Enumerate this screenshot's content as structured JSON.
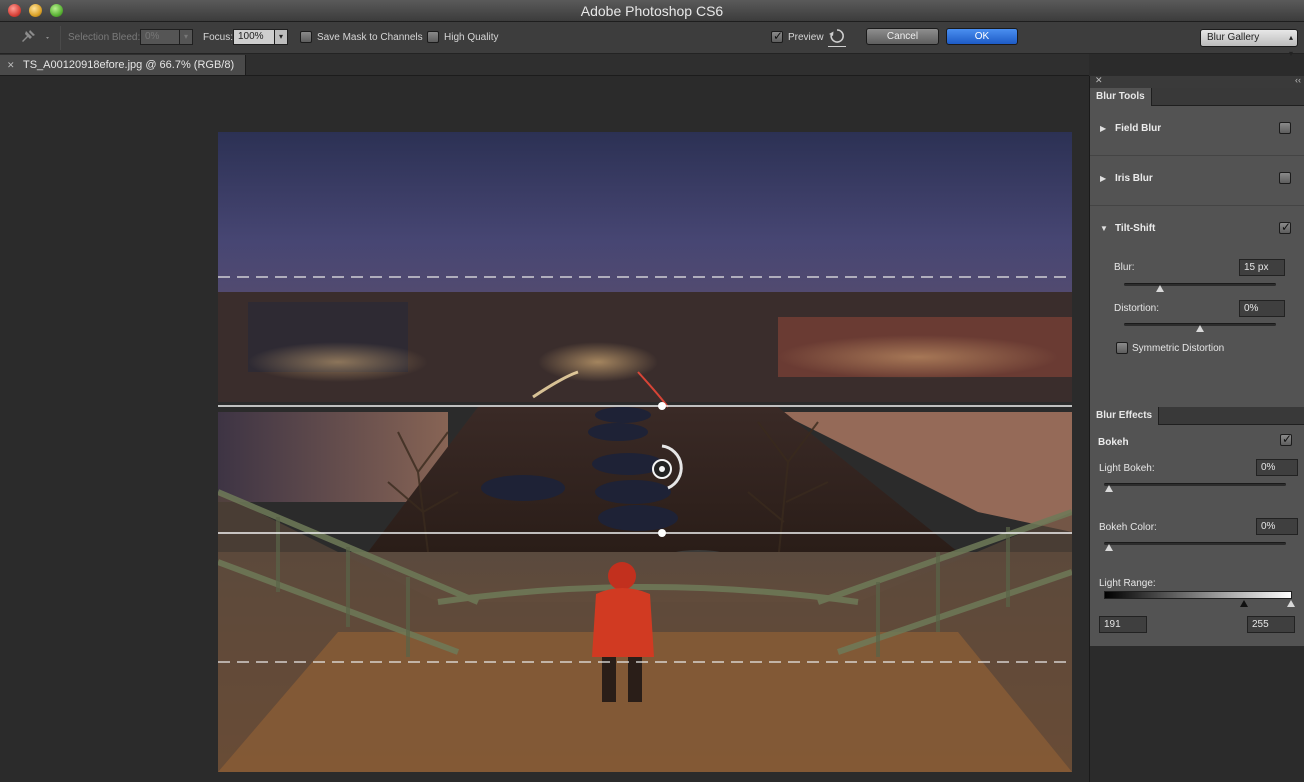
{
  "window": {
    "title": "Adobe Photoshop CS6"
  },
  "options_bar": {
    "selection_bleed_label": "Selection Bleed:",
    "selection_bleed_value": "0%",
    "focus_label": "Focus:",
    "focus_value": "100%",
    "save_mask_label": "Save Mask to Channels",
    "high_quality_label": "High Quality",
    "preview_label": "Preview",
    "preview_checked": true,
    "cancel_label": "Cancel",
    "ok_label": "OK",
    "workspace_label": "Blur Gallery"
  },
  "document": {
    "tab_title": "TS_A00120918efore.jpg @ 66.7% (RGB/8)"
  },
  "blur_tools": {
    "tab_label": "Blur Tools",
    "field_blur_label": "Field Blur",
    "iris_blur_label": "Iris Blur",
    "tilt_shift_label": "Tilt-Shift",
    "blur_label": "Blur:",
    "blur_value": "15 px",
    "distortion_label": "Distortion:",
    "distortion_value": "0%",
    "symmetric_label": "Symmetric Distortion"
  },
  "blur_effects": {
    "tab_label": "Blur Effects",
    "bokeh_label": "Bokeh",
    "light_bokeh_label": "Light Bokeh:",
    "light_bokeh_value": "0%",
    "bokeh_color_label": "Bokeh Color:",
    "bokeh_color_value": "0%",
    "light_range_label": "Light Range:",
    "light_range_low": "191",
    "light_range_high": "255"
  },
  "icons": {
    "pin": "pin-icon",
    "reset": "reset-icon",
    "close": "close-icon",
    "collapse": "double-chevron-icon"
  },
  "colors": {
    "ok_button": "#2f6fdc",
    "panel_bg": "#535353",
    "app_bg": "#2b2b2b"
  }
}
